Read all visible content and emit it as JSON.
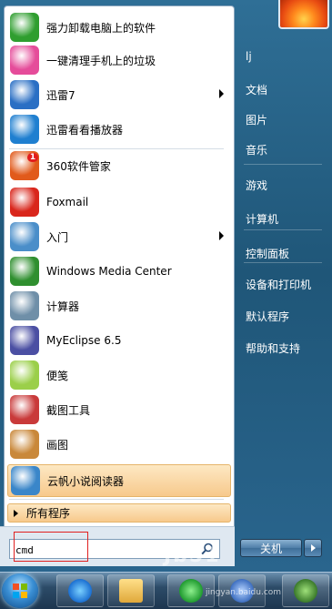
{
  "programs": [
    {
      "label": "强力卸载电脑上的软件",
      "icon": "uninstall-software-icon",
      "color": "#2f9e2f",
      "arrow": false
    },
    {
      "label": "一键清理手机上的垃圾",
      "icon": "phone-cleaner-icon",
      "color": "#e54c9a",
      "arrow": false
    },
    {
      "label": "迅雷7",
      "icon": "xunlei-bird-icon",
      "color": "#2a6fc4",
      "arrow": true
    },
    {
      "label": "迅雷看看播放器",
      "icon": "xunlei-player-icon",
      "color": "#1f7fd0",
      "arrow": false
    },
    {
      "label": "360软件管家",
      "icon": "360-software-manager-icon",
      "color": "#e15a1b",
      "arrow": false,
      "badge": "1"
    },
    {
      "label": "Foxmail",
      "icon": "foxmail-icon",
      "color": "#d9261c",
      "arrow": false
    },
    {
      "label": "入门",
      "icon": "getting-started-icon",
      "color": "#4a8ec9",
      "arrow": true
    },
    {
      "label": "Windows Media Center",
      "icon": "windows-media-center-icon",
      "color": "#2f8f2f",
      "arrow": false
    },
    {
      "label": "计算器",
      "icon": "calculator-icon",
      "color": "#6f8fa8",
      "arrow": false
    },
    {
      "label": "MyEclipse 6.5",
      "icon": "myeclipse-icon",
      "color": "#4b4fa3",
      "arrow": false
    },
    {
      "label": "便笺",
      "icon": "sticky-notes-icon",
      "color": "#9bcf4a",
      "arrow": false
    },
    {
      "label": "截图工具",
      "icon": "snipping-tool-icon",
      "color": "#c93a3a",
      "arrow": false
    },
    {
      "label": "画图",
      "icon": "paint-icon",
      "color": "#c9883a",
      "arrow": false
    },
    {
      "label": "云帆小说阅读器",
      "icon": "yunfan-reader-icon",
      "color": "#3a86c9",
      "arrow": false
    }
  ],
  "all_programs_label": "所有程序",
  "search": {
    "value": "cmd",
    "placeholder": ""
  },
  "right_items": [
    {
      "label": "lj"
    },
    {
      "label": "文档"
    },
    {
      "label": "图片"
    },
    {
      "label": "音乐"
    },
    {
      "label": "游戏"
    },
    {
      "label": "计算机"
    },
    {
      "label": "控制面板"
    },
    {
      "label": "设备和打印机"
    },
    {
      "label": "默认程序"
    },
    {
      "label": "帮助和支持"
    }
  ],
  "shutdown_label": "关机",
  "watermark": "Jb51",
  "watermark_sub": "jingyan.baidu.com"
}
